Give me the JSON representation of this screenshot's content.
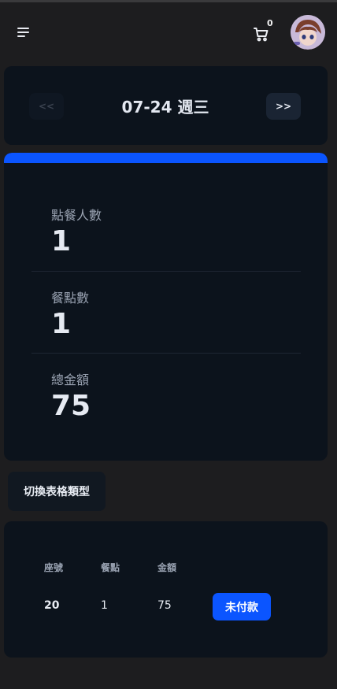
{
  "header": {
    "cart_count": "0",
    "icons": {
      "menu": "menu-icon",
      "cart": "cart-icon",
      "avatar": "user-avatar"
    }
  },
  "date_nav": {
    "prev_label": "<<",
    "next_label": ">>",
    "date": "07-24 週三"
  },
  "stats": {
    "accent_color": "#0b55ff",
    "items": [
      {
        "label": "點餐人數",
        "value": "1"
      },
      {
        "label": "餐點數",
        "value": "1"
      },
      {
        "label": "總金額",
        "value": "75"
      }
    ]
  },
  "toggle_table_label": "切換表格類型",
  "orders_table": {
    "headers": [
      "座號",
      "餐點",
      "金額"
    ],
    "rows": [
      {
        "seat": "20",
        "items": "1",
        "amount": "75",
        "status": "未付款"
      }
    ]
  }
}
